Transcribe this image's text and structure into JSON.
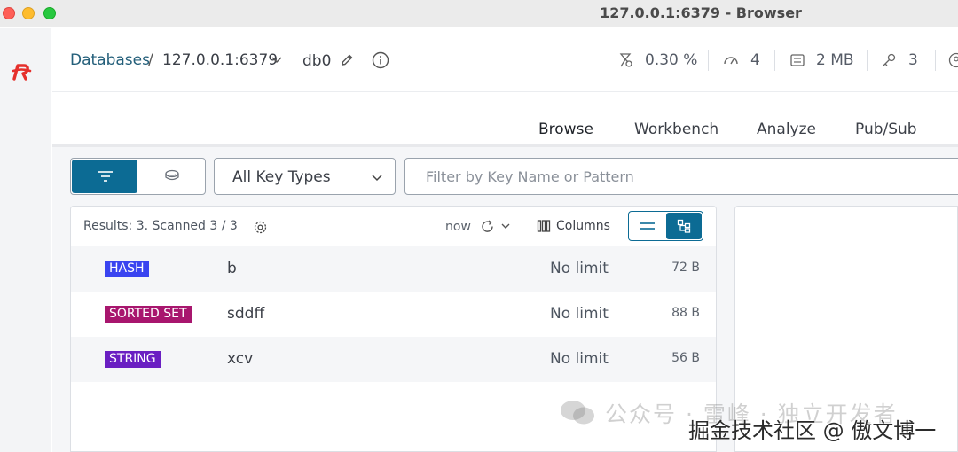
{
  "window": {
    "title": "127.0.0.1:6379 - Browser"
  },
  "breadcrumb": {
    "databases": "Databases",
    "separator": "/",
    "host": "127.0.0.1:6379",
    "db": "db0"
  },
  "stats": {
    "cpu": "0.30 %",
    "connections": "4",
    "memory": "2 MB",
    "keys": "3"
  },
  "tabs": [
    {
      "label": "Browse",
      "active": true
    },
    {
      "label": "Workbench",
      "active": false
    },
    {
      "label": "Analyze",
      "active": false
    },
    {
      "label": "Pub/Sub",
      "active": false
    }
  ],
  "toolbar": {
    "key_type_select": "All Key Types",
    "search_placeholder": "Filter by Key Name or Pattern"
  },
  "results": {
    "summary": "Results: 3. Scanned 3 / 3",
    "refresh_time": "now",
    "columns_label": "Columns",
    "rows": [
      {
        "type": "HASH",
        "type_color": "#3a44f0",
        "name": "b",
        "ttl": "No limit",
        "size": "72 B"
      },
      {
        "type": "SORTED SET",
        "type_color": "#a8166e",
        "name": "sddff",
        "ttl": "No limit",
        "size": "88 B"
      },
      {
        "type": "STRING",
        "type_color": "#6a1fc2",
        "name": "xcv",
        "ttl": "No limit",
        "size": "56 B"
      }
    ]
  },
  "colors": {
    "accent": "#0c6b94",
    "link": "#245f7a"
  },
  "watermark": {
    "line1": "公众号 · 雷峰 · 独立开发者",
    "line2": "掘金技术社区 @ 傲文博一"
  }
}
